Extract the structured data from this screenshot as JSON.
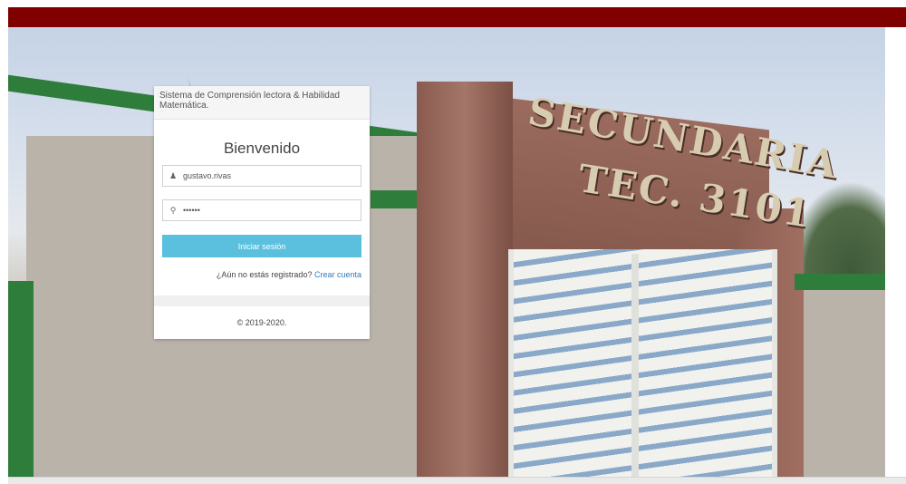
{
  "colors": {
    "top_bar": "#800000",
    "button": "#5bc0de",
    "link": "#337ab7"
  },
  "background": {
    "sign_line1": "SECUNDARIA",
    "sign_line2": "TEC. 3101"
  },
  "card": {
    "header": "Sistema de Comprensión lectora & Habilidad Matemática.",
    "welcome": "Bienvenido",
    "username": {
      "icon": "user-icon",
      "value": "gustavo.rivas"
    },
    "password": {
      "icon": "key-icon",
      "value": "••••••"
    },
    "login_button": "Iniciar sesión",
    "register_prompt": "¿Aún no estás registrado?",
    "register_link": "Crear cuenta",
    "footer": "© 2019-2020."
  }
}
